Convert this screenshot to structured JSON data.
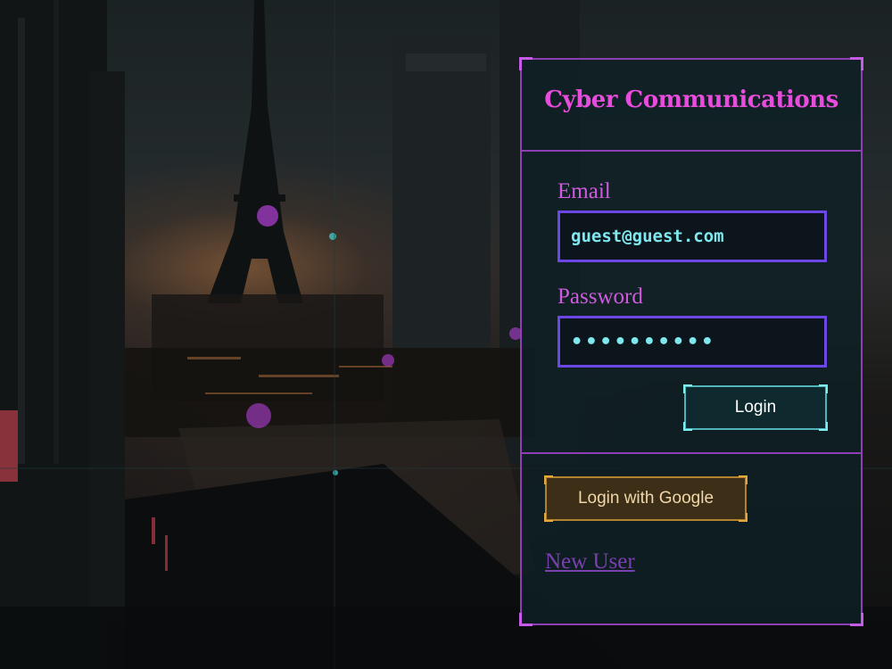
{
  "panel": {
    "title": "Cyber Communications"
  },
  "form": {
    "email_label": "Email",
    "email_value": "guest@guest.com",
    "password_label": "Password",
    "password_value": "••••••••••",
    "login_label": "Login"
  },
  "alt": {
    "google_label": "Login with Google",
    "new_user_label": "New User"
  },
  "colors": {
    "accent_magenta": "#e84cdc",
    "panel_border": "#8e3fb6",
    "input_border": "#6d46e6",
    "input_text": "#7fe8ef",
    "login_border": "#4fb3b8",
    "google_border": "#b2822f"
  }
}
